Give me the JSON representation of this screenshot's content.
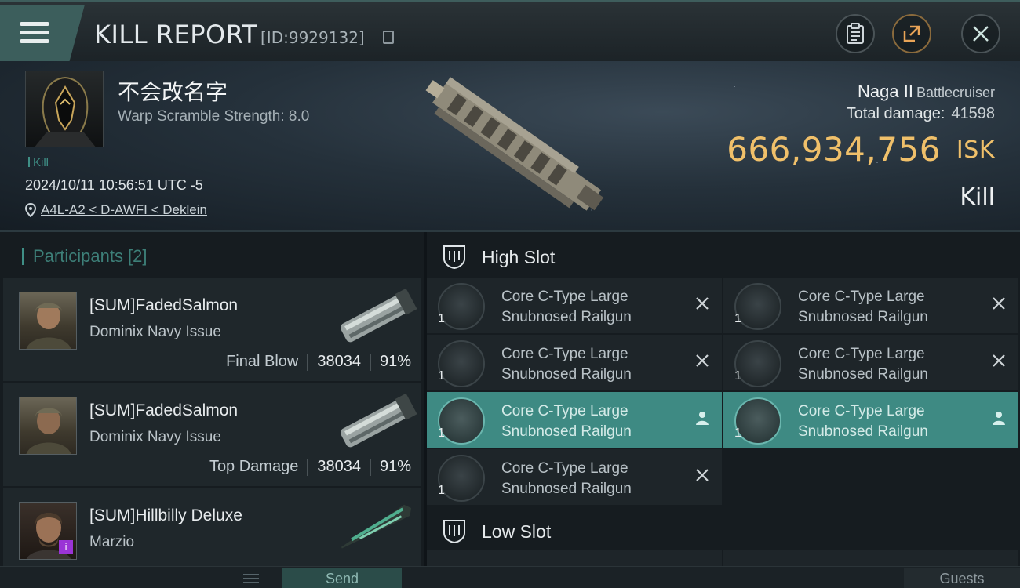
{
  "header": {
    "title": "KILL REPORT",
    "report_id": "[ID:9929132]"
  },
  "victim": {
    "name": "不会改名字",
    "warp_scramble": "Warp Scramble Strength: 8.0",
    "tag": "Kill",
    "datetime": "2024/10/11 10:56:51 UTC -5",
    "location": "A4L-A2 < D-AWFI < Deklein",
    "ship": "Naga II",
    "ship_class": "Battlecruiser",
    "total_damage_label": "Total damage:",
    "total_damage": "41598",
    "isk_value": "666,934,756",
    "isk_unit": "ISK",
    "result": "Kill"
  },
  "participants": {
    "title": "Participants [2]",
    "rows": [
      {
        "name": "[SUM]FadedSalmon",
        "ship": "Dominix Navy Issue",
        "label": "Final Blow",
        "damage": "38034",
        "percent": "91%"
      },
      {
        "name": "[SUM]FadedSalmon",
        "ship": "Dominix Navy Issue",
        "label": "Top Damage",
        "damage": "38034",
        "percent": "91%"
      },
      {
        "name": "[SUM]Hillbilly Deluxe",
        "ship": "Marzio",
        "label": "",
        "damage": "",
        "percent": ""
      }
    ]
  },
  "slots": {
    "high_title": "High Slot",
    "low_title": "Low Slot",
    "high_items": [
      {
        "name_line1": "Core C-Type Large",
        "name_line2": "Snubnosed Railgun",
        "qty": "1",
        "status": "destroyed"
      },
      {
        "name_line1": "Core C-Type Large",
        "name_line2": "Snubnosed Railgun",
        "qty": "1",
        "status": "destroyed"
      },
      {
        "name_line1": "Core C-Type Large",
        "name_line2": "Snubnosed Railgun",
        "qty": "1",
        "status": "destroyed"
      },
      {
        "name_line1": "Core C-Type Large",
        "name_line2": "Snubnosed Railgun",
        "qty": "1",
        "status": "destroyed"
      },
      {
        "name_line1": "Core C-Type Large",
        "name_line2": "Snubnosed Railgun",
        "qty": "1",
        "status": "dropped"
      },
      {
        "name_line1": "Core C-Type Large",
        "name_line2": "Snubnosed Railgun",
        "qty": "1",
        "status": "dropped"
      },
      {
        "name_line1": "Core C-Type Large",
        "name_line2": "Snubnosed Railgun",
        "qty": "1",
        "status": "destroyed"
      }
    ]
  },
  "bottom_bar": {
    "send_label": "Send",
    "guests_label": "Guests"
  },
  "colors": {
    "accent": "#3e8a83",
    "isk": "#f0c06a",
    "header_tab": "#3c5e5c"
  }
}
